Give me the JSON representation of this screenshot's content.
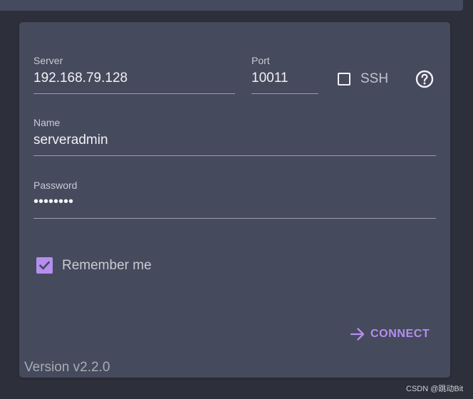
{
  "form": {
    "server": {
      "label": "Server",
      "value": "192.168.79.128"
    },
    "port": {
      "label": "Port",
      "value": "10011"
    },
    "ssh": {
      "label": "SSH",
      "checked": false
    },
    "name": {
      "label": "Name",
      "value": "serveradmin"
    },
    "password": {
      "label": "Password",
      "value": "••••••••"
    },
    "remember": {
      "label": "Remember me",
      "checked": true
    },
    "connect_label": "CONNECT",
    "help_icon": "help-circle-icon",
    "connect_icon": "arrow-right-icon"
  },
  "footer": {
    "version": "Version v2.2.0",
    "watermark": "CSDN @跳动Bit"
  },
  "colors": {
    "background": "#2d2f3b",
    "panel": "#464a5d",
    "accent": "#b58ef0",
    "text": "#f1f1f4",
    "label": "#c9cad2"
  }
}
